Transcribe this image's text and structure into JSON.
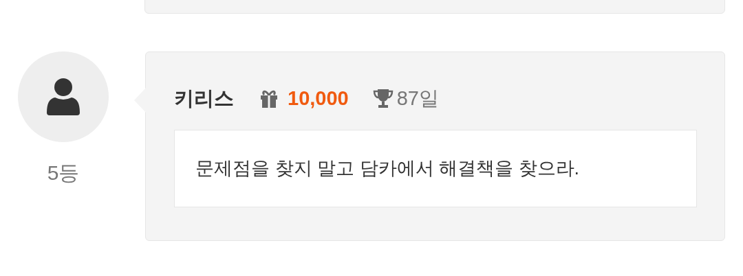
{
  "comment": {
    "rank": "5등",
    "name": "키리스",
    "points": "10,000",
    "days": "87일",
    "message": "문제점을 찾지 말고 담카에서 해결책을 찾으라."
  }
}
